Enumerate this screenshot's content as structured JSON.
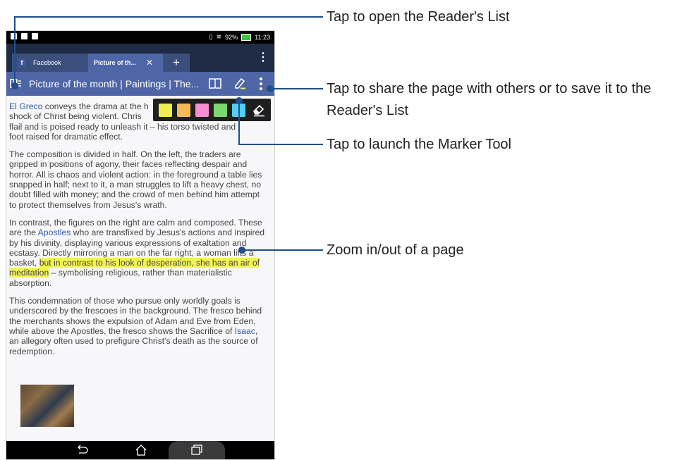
{
  "status_bar": {
    "battery": "92%",
    "time": "11:23"
  },
  "tabs": [
    {
      "label": "Facebook",
      "icon": "facebook-icon"
    },
    {
      "label": "Picture of th...",
      "icon": "close-icon"
    }
  ],
  "new_tab_label": "+",
  "url_bar": {
    "title": "Picture of the month | Paintings | The..."
  },
  "marker_palette": [
    "#f1ef4f",
    "#f5b85a",
    "#f48fd3",
    "#7dd76f",
    "#54cff3"
  ],
  "article": {
    "p1": [
      {
        "t": "El Greco",
        "link": true
      },
      {
        "t": " conveys the drama at the h"
      },
      {
        "t": "shock of Christ being violent. Chris"
      },
      {
        "t": "flail and is poised ready to unleash it – his torso twisted and"
      },
      {
        "t": "foot raised for dramatic effect."
      }
    ],
    "p2": "The composition is divided in half. On the left, the traders are gripped in positions of agony, their faces reflecting despair and horror. All is chaos and violent action: in the foreground a table lies snapped in half; next to it, a man struggles to lift a heavy chest, no doubt filled with money; and the crowd of men behind him attempt to protect themselves from Jesus's wrath.",
    "p3_a": "In contrast, the figures on the right are calm and composed. These are the ",
    "p3_link": "Apostles",
    "p3_b": " who are transfixed by Jesus's actions and inspired by his divinity, displaying various expressions of exaltation and ecstasy. Directly mirroring a man on the far right, a woman lifts a basket, ",
    "p3_highlight": "but in contrast to his look of desperation, she has an air of meditation",
    "p3_c": " – symbolising religious, rather than materialistic absorption.",
    "p4_a": "This condemnation of those who pursue only worldly goals is underscored by the frescoes in the background. The fresco behind the merchants shows the expulsion of Adam and Eve from Eden, while above the Apostles, the fresco shows the Sacrifice of ",
    "p4_link": "Isaac",
    "p4_b": ", an allegory often used to prefigure Christ's death as the source of redemption."
  },
  "callouts": {
    "readers_list": "Tap to open the Reader's List",
    "share_line1": "Tap to share the page with others or to save it to the",
    "share_line2": "Reader's List",
    "marker_tool": "Tap to launch the Marker Tool",
    "zoom": "Zoom in/out of a page"
  },
  "colors": {
    "callout_line": "#1f4e8c",
    "tab_bar": "#1f2a44",
    "url_bar": "#4f66a6",
    "highlight": "#f2f25a",
    "link": "#3156a8"
  }
}
